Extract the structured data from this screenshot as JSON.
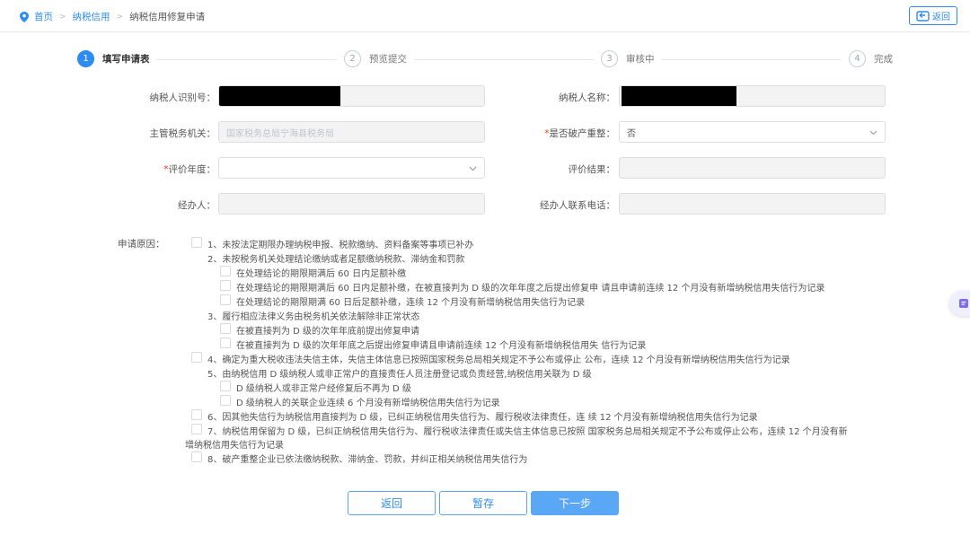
{
  "breadcrumb": {
    "home": "首页",
    "section": "纳税信用",
    "current": "纳税信用修复申请"
  },
  "back_button": "返回",
  "steps": [
    {
      "num": "1",
      "label": "填写申请表",
      "active": true
    },
    {
      "num": "2",
      "label": "预览提交",
      "active": false
    },
    {
      "num": "3",
      "label": "审核中",
      "active": false
    },
    {
      "num": "4",
      "label": "完成",
      "active": false
    }
  ],
  "form": {
    "taxpayer_id_label": "纳税人识别号：",
    "taxpayer_name_label": "纳税人名称：",
    "tax_authority_label": "主管税务机关：",
    "tax_authority_value": "国家税务总局宁海县税务局",
    "bankruptcy_label": "是否破产重整：",
    "bankruptcy_value": "否",
    "eval_year_label": "评价年度：",
    "eval_year_value": "",
    "eval_result_label": "评价结果：",
    "agent_label": "经办人：",
    "agent_phone_label": "经办人联系电话："
  },
  "reasons": {
    "title": "申请原因：",
    "items": [
      "1、未按法定期限办理纳税申报、税款缴纳、资料备案等事项已补办",
      "2、未按税务机关处理结论缴纳或者足额缴纳税款、滞纳金和罚款",
      "在处理结论的期限期满后 60 日内足额补缴",
      "在处理结论的期限期满后 60 日内足额补缴，在被直接判为 D 级的次年年度之后提出修复申 请且申请前连续 12 个月没有新增纳税信用失信行为记录",
      "在处理结论的期限期满 60 日后足额补缴，连续 12 个月没有新增纳税信用失信行为记录",
      "3、履行相应法律义务由税务机关依法解除非正常状态",
      "在被直接判为 D 级的次年年底前提出修复申请",
      "在被直接判为 D 级的次年年底之后提出修复申请且申请前连续 12 个月没有新增纳税信用失 信行为记录",
      "4、确定为重大税收违法失信主体，失信主体信息已按照国家税务总局相关规定不予公布或停止 公布，连续 12 个月没有新增纳税信用失信行为记录",
      "5、由纳税信用 D 级纳税人或非正常户的直接责任人员注册登记或负责经营,纳税信用关联为 D 级",
      "D 级纳税人或非正常户经修复后不再为 D 级",
      "D 级纳税人的关联企业连续 6 个月没有新增纳税信用失信行为记录",
      "6、因其他失信行为纳税信用直接判为 D 级，已纠正纳税信用失信行为、履行税收法律责任，连 续 12 个月没有新增纳税信用失信行为记录",
      "7、纳税信用保留为 D 级，已纠正纳税信用失信行为、履行税收法律责任或失信主体信息已按照 国家税务总局相关规定不予公布或停止公布，连续 12 个月没有新",
      "增纳税信用失信行为记录",
      "8、破产重整企业已依法缴纳税款、滞纳金、罚款，并纠正相关纳税信用失信行为"
    ]
  },
  "buttons": {
    "back": "返回",
    "save": "暂存",
    "next": "下一步"
  }
}
